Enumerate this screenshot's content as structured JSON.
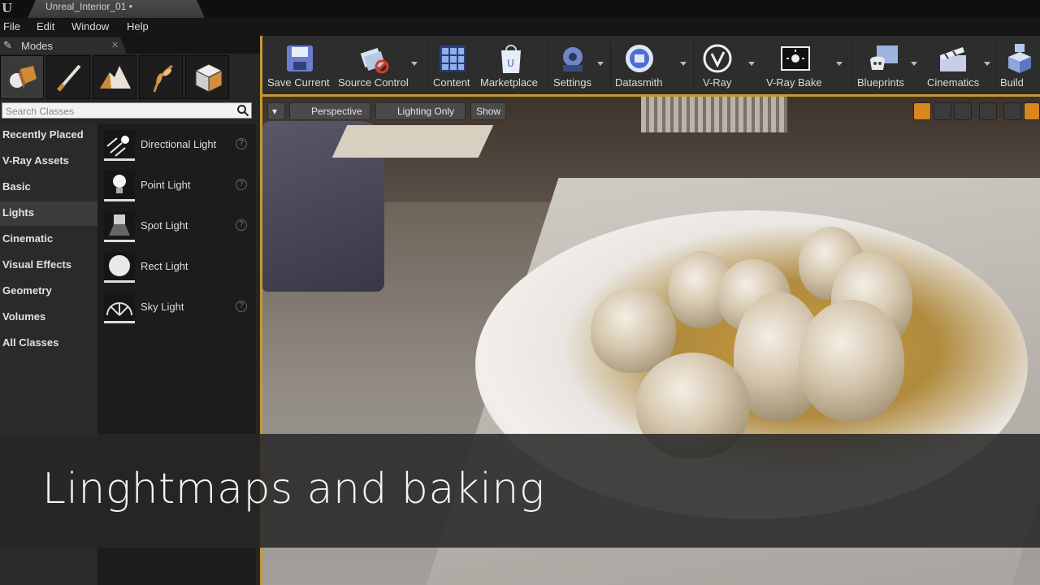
{
  "window": {
    "tab_title": "Unreal_Interior_01 •"
  },
  "menu": [
    "File",
    "Edit",
    "Window",
    "Help"
  ],
  "modes": {
    "tab_label": "Modes",
    "search_placeholder": "Search Classes",
    "categories": [
      "Recently Placed",
      "V-Ray Assets",
      "Basic",
      "Lights",
      "Cinematic",
      "Visual Effects",
      "Geometry",
      "Volumes",
      "All Classes"
    ],
    "active_category": "Lights",
    "items": [
      {
        "label": "Directional Light",
        "icon": "directional-light-icon",
        "help": true
      },
      {
        "label": "Point Light",
        "icon": "point-light-icon",
        "help": true
      },
      {
        "label": "Spot Light",
        "icon": "spot-light-icon",
        "help": true
      },
      {
        "label": "Rect Light",
        "icon": "rect-light-icon",
        "help": false
      },
      {
        "label": "Sky Light",
        "icon": "sky-light-icon",
        "help": true
      }
    ]
  },
  "toolbar": {
    "buttons": [
      {
        "label": "Save Current",
        "icon": "save-icon",
        "dropdown": false
      },
      {
        "label": "Source Control",
        "icon": "source-control-icon",
        "dropdown": true
      },
      {
        "label": "Content",
        "icon": "content-icon",
        "dropdown": false
      },
      {
        "label": "Marketplace",
        "icon": "marketplace-icon",
        "dropdown": false
      },
      {
        "label": "Settings",
        "icon": "settings-icon",
        "dropdown": true
      },
      {
        "label": "Datasmith",
        "icon": "datasmith-icon",
        "dropdown": true
      },
      {
        "label": "V-Ray",
        "icon": "vray-icon",
        "dropdown": true
      },
      {
        "label": "V-Ray Bake",
        "icon": "vray-bake-icon",
        "dropdown": true
      },
      {
        "label": "Blueprints",
        "icon": "blueprints-icon",
        "dropdown": true
      },
      {
        "label": "Cinematics",
        "icon": "cinematics-icon",
        "dropdown": true
      },
      {
        "label": "Build",
        "icon": "build-icon",
        "dropdown": false
      }
    ]
  },
  "viewport": {
    "menu_label": "▾",
    "projection": "Perspective",
    "view_mode": "Lighting Only",
    "show": "Show"
  },
  "caption": {
    "text": "Linghtmaps and baking"
  },
  "colors": {
    "accent": "#c69a2e",
    "panel": "#262626",
    "toolbar": "#2d2d2d"
  }
}
